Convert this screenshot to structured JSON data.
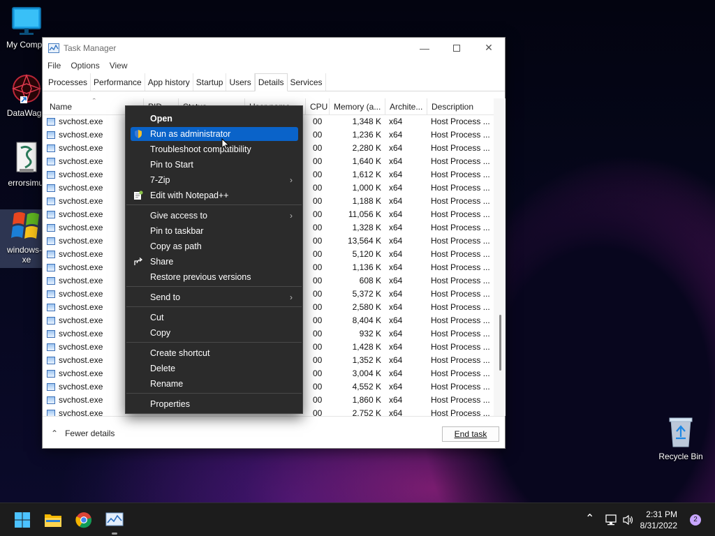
{
  "desktop": {
    "icons": [
      {
        "label": "My Compu",
        "icon": "monitor-icon"
      },
      {
        "label": "DataWago",
        "icon": "datawagon-icon"
      },
      {
        "label": "errorsimul",
        "icon": "script-icon"
      },
      {
        "label": "windows-x",
        "label2": "xe",
        "icon": "windows-xp-logo-icon"
      },
      {
        "label": "Recycle Bin",
        "icon": "recycle-bin-icon"
      }
    ]
  },
  "window": {
    "title": "Task Manager",
    "menu": [
      "File",
      "Options",
      "View"
    ],
    "tabs": [
      "Processes",
      "Performance",
      "App history",
      "Startup",
      "Users",
      "Details",
      "Services"
    ],
    "active_tab": "Details",
    "columns": [
      "Name",
      "PID",
      "Status",
      "User name",
      "CPU",
      "Memory (a...",
      "Archite...",
      "Description"
    ],
    "rows": [
      {
        "name": "svchost.exe",
        "cpu": "00",
        "memory": "1,348 K",
        "arch": "x64",
        "desc": "Host Process ..."
      },
      {
        "name": "svchost.exe",
        "cpu": "00",
        "memory": "1,236 K",
        "arch": "x64",
        "desc": "Host Process ..."
      },
      {
        "name": "svchost.exe",
        "cpu": "00",
        "memory": "2,280 K",
        "arch": "x64",
        "desc": "Host Process ..."
      },
      {
        "name": "svchost.exe",
        "cpu": "00",
        "memory": "1,640 K",
        "arch": "x64",
        "desc": "Host Process ..."
      },
      {
        "name": "svchost.exe",
        "cpu": "00",
        "memory": "1,612 K",
        "arch": "x64",
        "desc": "Host Process ..."
      },
      {
        "name": "svchost.exe",
        "cpu": "00",
        "memory": "1,000 K",
        "arch": "x64",
        "desc": "Host Process ..."
      },
      {
        "name": "svchost.exe",
        "cpu": "00",
        "memory": "1,188 K",
        "arch": "x64",
        "desc": "Host Process ..."
      },
      {
        "name": "svchost.exe",
        "cpu": "00",
        "memory": "11,056 K",
        "arch": "x64",
        "desc": "Host Process ..."
      },
      {
        "name": "svchost.exe",
        "cpu": "00",
        "memory": "1,328 K",
        "arch": "x64",
        "desc": "Host Process ..."
      },
      {
        "name": "svchost.exe",
        "cpu": "00",
        "memory": "13,564 K",
        "arch": "x64",
        "desc": "Host Process ..."
      },
      {
        "name": "svchost.exe",
        "cpu": "00",
        "memory": "5,120 K",
        "arch": "x64",
        "desc": "Host Process ..."
      },
      {
        "name": "svchost.exe",
        "cpu": "00",
        "memory": "1,136 K",
        "arch": "x64",
        "desc": "Host Process ..."
      },
      {
        "name": "svchost.exe",
        "cpu": "00",
        "memory": "608 K",
        "arch": "x64",
        "desc": "Host Process ..."
      },
      {
        "name": "svchost.exe",
        "cpu": "00",
        "memory": "5,372 K",
        "arch": "x64",
        "desc": "Host Process ..."
      },
      {
        "name": "svchost.exe",
        "cpu": "00",
        "memory": "2,580 K",
        "arch": "x64",
        "desc": "Host Process ..."
      },
      {
        "name": "svchost.exe",
        "cpu": "00",
        "memory": "8,404 K",
        "arch": "x64",
        "desc": "Host Process ..."
      },
      {
        "name": "svchost.exe",
        "cpu": "00",
        "memory": "932 K",
        "arch": "x64",
        "desc": "Host Process ..."
      },
      {
        "name": "svchost.exe",
        "cpu": "00",
        "memory": "1,428 K",
        "arch": "x64",
        "desc": "Host Process ..."
      },
      {
        "name": "svchost.exe",
        "cpu": "00",
        "memory": "1,352 K",
        "arch": "x64",
        "desc": "Host Process ..."
      },
      {
        "name": "svchost.exe",
        "cpu": "00",
        "memory": "3,004 K",
        "arch": "x64",
        "desc": "Host Process ..."
      },
      {
        "name": "svchost.exe",
        "cpu": "00",
        "memory": "4,552 K",
        "arch": "x64",
        "desc": "Host Process ..."
      },
      {
        "name": "svchost.exe",
        "cpu": "00",
        "memory": "1,860 K",
        "arch": "x64",
        "desc": "Host Process ..."
      },
      {
        "name": "svchost.exe",
        "cpu": "00",
        "memory": "2,752 K",
        "arch": "x64",
        "desc": "Host Process ..."
      }
    ],
    "fewer_details": "Fewer details",
    "end_task": "End task"
  },
  "context_menu": {
    "items": [
      {
        "label": "Open",
        "bold": true
      },
      {
        "label": "Run as administrator",
        "icon": "uac-shield-icon",
        "highlighted": true
      },
      {
        "label": "Troubleshoot compatibility"
      },
      {
        "label": "Pin to Start"
      },
      {
        "label": "7-Zip",
        "submenu": true
      },
      {
        "label": "Edit with Notepad++",
        "icon": "notepad-plus-plus-icon"
      },
      {
        "separator": true
      },
      {
        "label": "Give access to",
        "submenu": true
      },
      {
        "label": "Pin to taskbar"
      },
      {
        "label": "Copy as path"
      },
      {
        "label": "Share",
        "icon": "share-icon"
      },
      {
        "label": "Restore previous versions"
      },
      {
        "separator": true
      },
      {
        "label": "Send to",
        "submenu": true
      },
      {
        "separator": true
      },
      {
        "label": "Cut"
      },
      {
        "label": "Copy"
      },
      {
        "separator": true
      },
      {
        "label": "Create shortcut"
      },
      {
        "label": "Delete"
      },
      {
        "label": "Rename"
      },
      {
        "separator": true
      },
      {
        "label": "Properties"
      }
    ]
  },
  "taskbar": {
    "apps": [
      "start-button-icon",
      "file-explorer-icon",
      "chrome-icon",
      "task-manager-icon"
    ],
    "time": "2:31 PM",
    "date": "8/31/2022",
    "notification_count": "2"
  },
  "colors": {
    "menu_bg": "#2b2b2b",
    "highlight": "#0a63c9",
    "taskbar": "#1c1c1c"
  }
}
